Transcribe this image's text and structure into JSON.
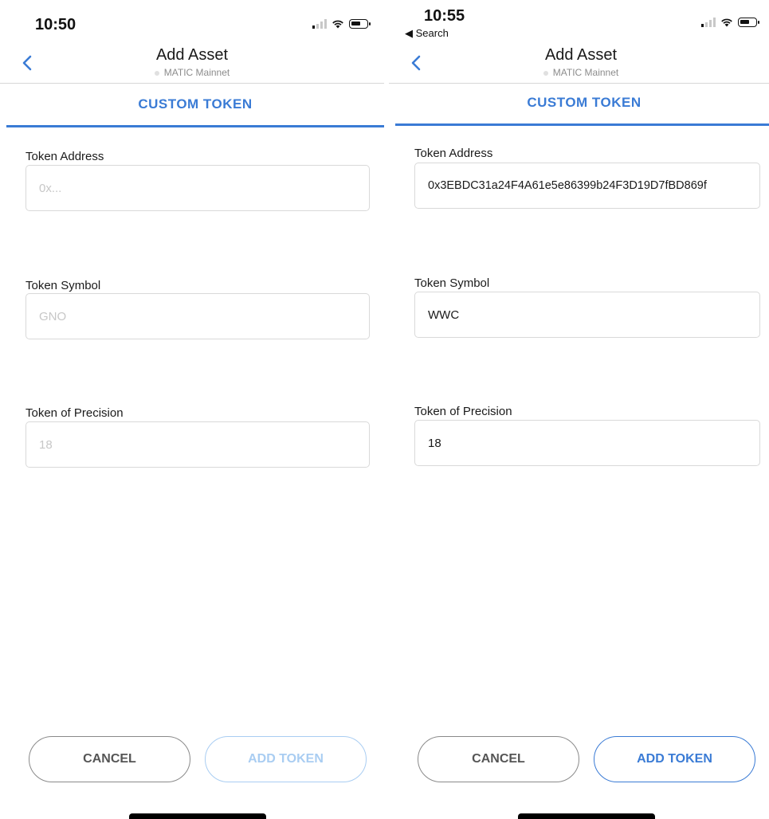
{
  "left": {
    "status_time": "10:50",
    "header": {
      "title": "Add Asset",
      "network": "MATIC Mainnet"
    },
    "tab": "CUSTOM TOKEN",
    "fields": {
      "address_label": "Token Address",
      "address_value": "",
      "address_placeholder": "0x...",
      "symbol_label": "Token Symbol",
      "symbol_value": "",
      "symbol_placeholder": "GNO",
      "precision_label": "Token of Precision",
      "precision_value": "",
      "precision_placeholder": "18"
    },
    "buttons": {
      "cancel": "CANCEL",
      "add_token": "ADD TOKEN",
      "add_token_state": "disabled"
    }
  },
  "right": {
    "status_time": "10:55",
    "back_to_app": "◀ Search",
    "header": {
      "title": "Add Asset",
      "network": "MATIC Mainnet"
    },
    "tab": "CUSTOM TOKEN",
    "fields": {
      "address_label": "Token Address",
      "address_value": "0x3EBDC31a24F4A61e5e86399b24F3D19D7fBD869f",
      "symbol_label": "Token Symbol",
      "symbol_value": "WWC",
      "precision_label": "Token of Precision",
      "precision_value": "18"
    },
    "buttons": {
      "cancel": "CANCEL",
      "add_token": "ADD TOKEN",
      "add_token_state": "enabled"
    }
  },
  "colors": {
    "accent": "#3a7bd5",
    "accent_disabled": "#a9cdf2",
    "border": "#d9d9d9",
    "placeholder": "#c7c7c7"
  }
}
